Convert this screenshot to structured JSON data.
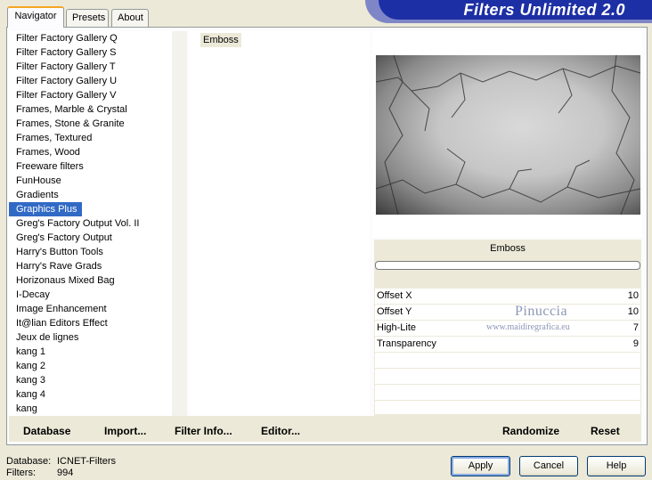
{
  "tabs": [
    {
      "label": "Navigator"
    },
    {
      "label": "Presets"
    },
    {
      "label": "About"
    }
  ],
  "banner": {
    "title": "Filters Unlimited 2.0"
  },
  "categories": [
    "Filter Factory Gallery Q",
    "Filter Factory Gallery S",
    "Filter Factory Gallery T",
    "Filter Factory Gallery U",
    "Filter Factory Gallery V",
    "Frames, Marble & Crystal",
    "Frames, Stone & Granite",
    "Frames, Textured",
    "Frames, Wood",
    "Freeware filters",
    "FunHouse",
    "Gradients",
    "Graphics Plus",
    "Greg's Factory Output Vol. II",
    "Greg's Factory Output",
    "Harry's Button Tools",
    "Harry's Rave Grads",
    "Horizonaus Mixed Bag",
    "I-Decay",
    "Image Enhancement",
    "It@lian Editors Effect",
    "Jeux de lignes",
    "kang 1",
    "kang 2",
    "kang 3",
    "kang 4",
    "kang"
  ],
  "selected_category": "Graphics Plus",
  "filters": [
    "Emboss"
  ],
  "filter_name": "Emboss",
  "params": [
    {
      "label": "Offset X",
      "value": "10"
    },
    {
      "label": "Offset Y",
      "value": "10"
    },
    {
      "label": "High-Lite",
      "value": "7"
    },
    {
      "label": "Transparency",
      "value": "9"
    }
  ],
  "toolbar": {
    "database": "Database",
    "import": "Import...",
    "filter_info": "Filter Info...",
    "editor": "Editor...",
    "randomize": "Randomize",
    "reset": "Reset"
  },
  "watermark": {
    "name": "Pinuccia",
    "site": "www.maidiregrafica.eu"
  },
  "status": {
    "database_label": "Database:",
    "database_value": "ICNET-Filters",
    "filters_label": "Filters:",
    "filters_value": "994"
  },
  "buttons": {
    "apply": "Apply",
    "cancel": "Cancel",
    "help": "Help"
  },
  "colors": {
    "selection": "#316ac5",
    "banner": "#1c2fa5",
    "face": "#ece9d8"
  }
}
